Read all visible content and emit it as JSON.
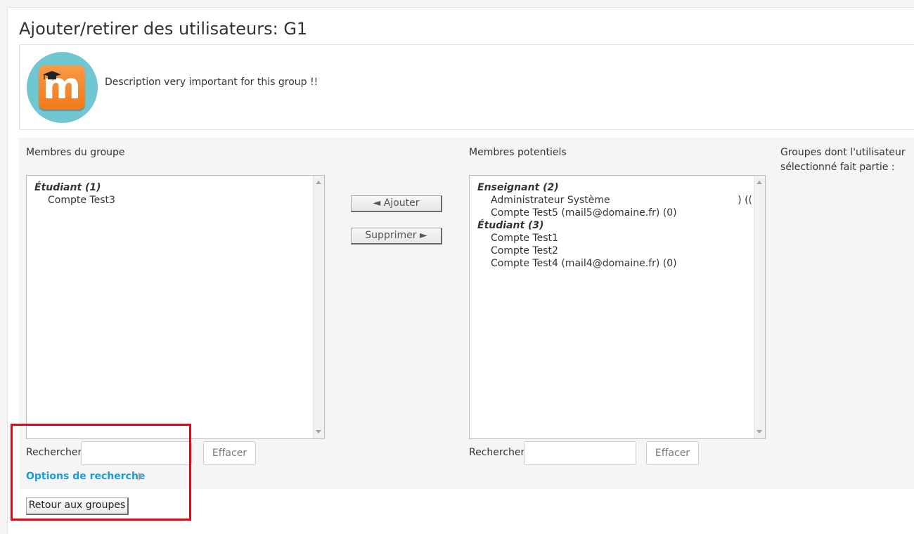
{
  "page": {
    "title": "Ajouter/retirer des utilisateurs: G1"
  },
  "group": {
    "description": "Description very important for this group !!",
    "picture_icon": "moodle-logo-icon"
  },
  "members": {
    "label": "Membres du groupe",
    "groups": [
      {
        "label": "Étudiant (1)",
        "options": [
          "Compte Test3"
        ]
      }
    ],
    "search_label": "Rechercher",
    "search_value": "",
    "clear_label": "Effacer"
  },
  "actions": {
    "add_label": "◄ Ajouter",
    "remove_label": "Supprimer ►"
  },
  "potential": {
    "label": "Membres potentiels",
    "groups": [
      {
        "label": "Enseignant (2)",
        "options": [
          "Administrateur Système",
          "Compte Test5 (mail5@domaine.fr) (0)"
        ],
        "option_tail": ") (("
      },
      {
        "label": "Étudiant (3)",
        "options": [
          "Compte Test1",
          "Compte Test2",
          "Compte Test4 (mail4@domaine.fr) (0)"
        ]
      }
    ],
    "search_label": "Rechercher",
    "search_value": "",
    "clear_label": "Effacer"
  },
  "user_groups": {
    "label_line1": "Groupes dont l'utilisateur",
    "label_line2": "sélectionné fait partie :"
  },
  "search_options": {
    "label": "Options de recherche"
  },
  "footer": {
    "back_label": "Retour aux groupes"
  },
  "colors": {
    "accent_link": "#1a9bd7",
    "highlight_box": "#e30613",
    "picture_background": "#70c6d1",
    "logo_orange": "#f07a1c"
  }
}
